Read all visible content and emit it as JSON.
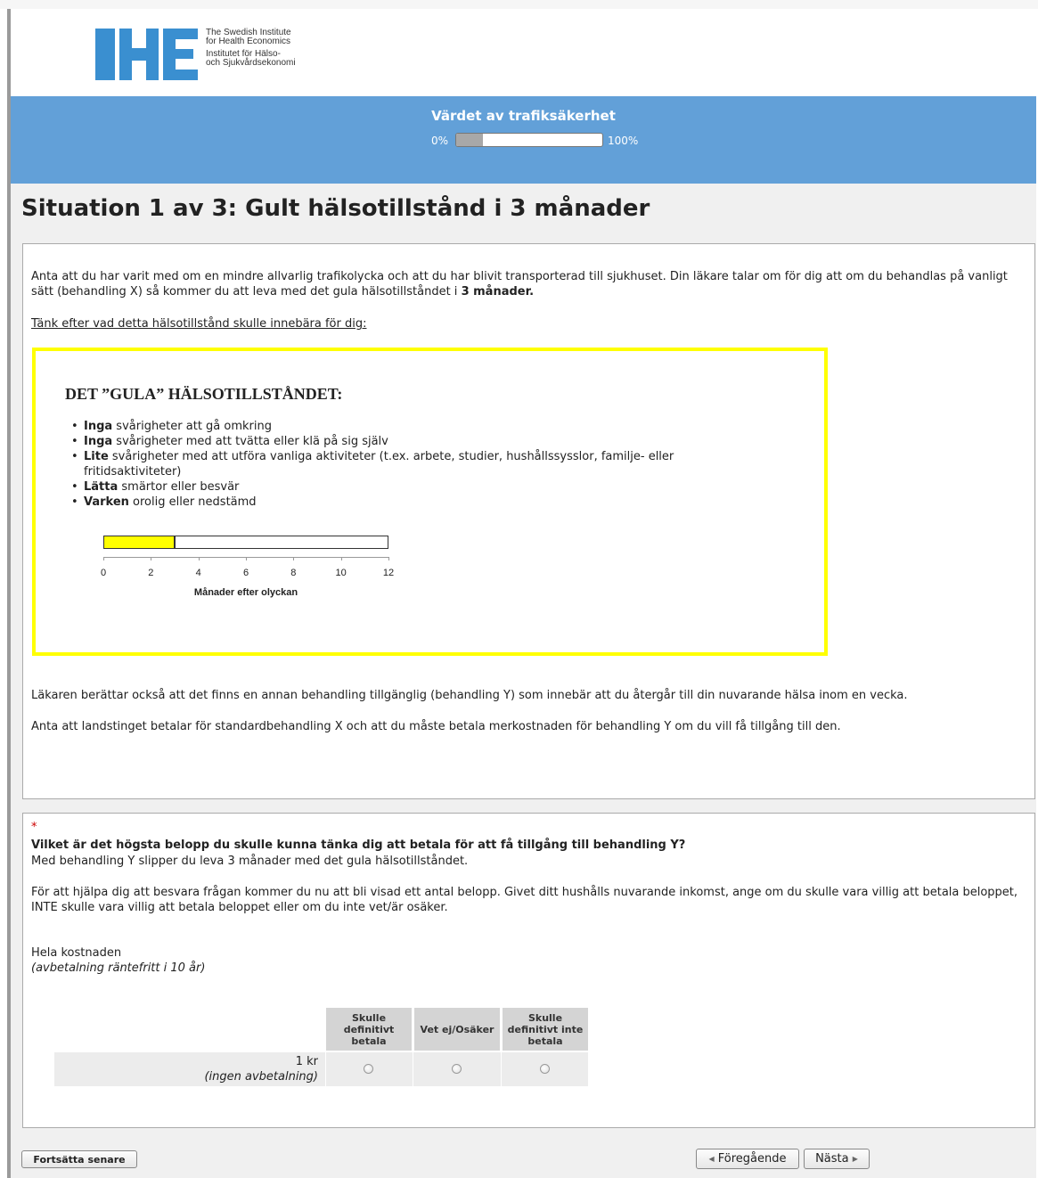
{
  "brand": {
    "logo_mark": "IHE",
    "line1": "The Swedish Institute",
    "line2": "for Health Economics",
    "line3": "Institutet för Hälso-",
    "line4": "och Sjukvårdsekonomi"
  },
  "survey": {
    "title": "Värdet av trafiksäkerhet",
    "progress_min": "0%",
    "progress_max": "100%",
    "progress_fraction": 0.18
  },
  "question_title": "Situation 1 av 3: Gult hälsotillstånd i 3 månader",
  "scenario": {
    "intro_text": "Anta att du har varit med om en mindre allvarlig trafikolycka och att du har blivit transporterad till sjukhuset. Din läkare talar om för dig att om du behandlas på vanligt sätt (behandling X) så kommer du att leva med det gula hälsotillståndet i ",
    "intro_bold": "3 månader.",
    "think_text": "Tänk efter vad detta hälsotillstånd skulle innebära för dig:",
    "state_title": "DET ”GULA” HÄLSOTILLSTÅNDET:",
    "items": [
      {
        "bold": "Inga",
        "text": " svårigheter att gå omkring"
      },
      {
        "bold": "Inga",
        "text": " svårigheter med att tvätta eller klä på sig själv"
      },
      {
        "bold": "Lite",
        "text": " svårigheter med att utföra vanliga aktiviteter (t.ex. arbete, studier, hushållssysslor, familje- eller fritidsaktiviteter)"
      },
      {
        "bold": "Lätta",
        "text": " smärtor eller besvär"
      },
      {
        "bold": "Varken",
        "text": " orolig eller nedstämd"
      }
    ],
    "timeline": {
      "months": 3,
      "max": 12,
      "ticks": [
        "0",
        "2",
        "4",
        "6",
        "8",
        "10",
        "12"
      ],
      "xlabel": "Månader efter olyckan"
    },
    "para2": "Läkaren berättar också att det finns en annan behandling tillgänglig (behandling Y) som innebär att du återgår till din nuvarande hälsa inom en vecka.",
    "para3": "Anta att landstinget betalar för standardbehandling X och att du måste betala merkostnaden för behandling Y om du vill få tillgång till den."
  },
  "question": {
    "required_mark": "*",
    "text": "Vilket är det högsta belopp du skulle kunna tänka dig att betala för att få tillgång till behandling Y?",
    "subtext": "Med behandling Y slipper du leva 3 månader med det gula hälsotillståndet.",
    "help": "För att hjälpa dig att besvara frågan kommer du nu att bli visad ett antal belopp. Givet ditt hushålls nuvarande inkomst, ange om du skulle vara villig att betala beloppet, INTE skulle vara villig att betala beloppet eller om du inte vet/är osäker.",
    "cost_label": "Hela kostnaden",
    "cost_sub": "(avbetalning räntefritt i 10 år)",
    "columns": [
      "Skulle definitivt betala",
      "Vet ej/Osäker",
      "Skulle definitivt inte betala"
    ],
    "rows": [
      {
        "amount": "1 kr",
        "note": "(ingen avbetalning)"
      }
    ]
  },
  "buttons": {
    "later": "Fortsätta senare",
    "prev": "Föregående",
    "next": "Nästa"
  },
  "colors": {
    "header_blue": "#62a0d8",
    "state_yellow": "#ffff00",
    "required_red": "#cc0000"
  }
}
